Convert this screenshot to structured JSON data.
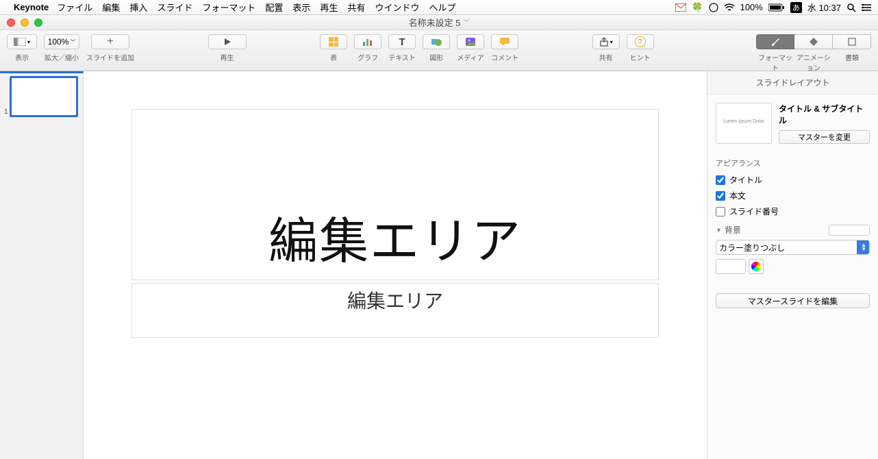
{
  "menubar": {
    "app": "Keynote",
    "items": [
      "ファイル",
      "編集",
      "挿入",
      "スライド",
      "フォーマット",
      "配置",
      "表示",
      "再生",
      "共有",
      "ウインドウ",
      "ヘルプ"
    ],
    "battery": "100%",
    "ime": "あ",
    "clock": "水 10:37"
  },
  "window": {
    "title": "名称未設定 5"
  },
  "toolbar": {
    "view": {
      "label": "表示"
    },
    "zoom": {
      "value": "100%",
      "label": "拡大／縮小"
    },
    "add_slide": {
      "label": "スライドを追加"
    },
    "play": {
      "label": "再生"
    },
    "table": {
      "label": "表"
    },
    "chart": {
      "label": "グラフ"
    },
    "text": {
      "label": "テキスト",
      "glyph": "T"
    },
    "shape": {
      "label": "図形"
    },
    "media": {
      "label": "メディア"
    },
    "comment": {
      "label": "コメント"
    },
    "share": {
      "label": "共有"
    },
    "tips": {
      "label": "ヒント",
      "glyph": "?"
    },
    "inspector": {
      "format": "フォーマット",
      "animate": "アニメーション",
      "document": "書類"
    }
  },
  "nav": {
    "slide1_num": "1"
  },
  "slide": {
    "title": "編集エリア",
    "subtitle": "編集エリア"
  },
  "inspector": {
    "header": "スライドレイアウト",
    "layout_name": "タイトル & サブタイトル",
    "layout_thumb_main": "Lorem Ipsum Dolor",
    "change_master": "マスターを変更",
    "appearance": "アピアランス",
    "cb_title": "タイトル",
    "cb_body": "本文",
    "cb_slidenum": "スライド番号",
    "background": "背景",
    "fill_type": "カラー塗りつぶし",
    "edit_master": "マスタースライドを編集"
  }
}
